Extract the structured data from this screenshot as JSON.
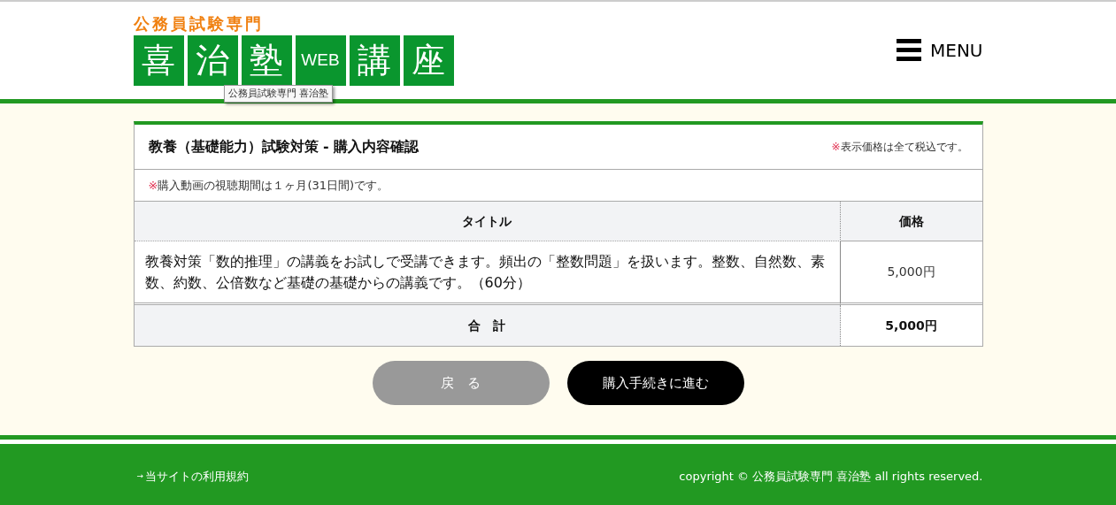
{
  "header": {
    "logo_caption": "公務員試験専門",
    "logo_tiles": [
      {
        "text": "喜",
        "kind": "kanji"
      },
      {
        "text": "治",
        "kind": "kanji"
      },
      {
        "text": "塾",
        "kind": "kanji"
      },
      {
        "text": "WEB",
        "kind": "latin"
      },
      {
        "text": "講",
        "kind": "kanji"
      },
      {
        "text": "座",
        "kind": "kanji"
      }
    ],
    "tooltip": "公務員試験専門 喜治塾",
    "menu_label": "MENU"
  },
  "panel": {
    "title": "教養（基礎能力）試験対策 - 購入内容確認",
    "tax_mark": "※",
    "tax_note": "表示価格は全て税込です。",
    "period_mark": "※",
    "period_note": "購入動画の視聴期間は１ヶ月(31日間)です。",
    "columns": [
      "タイトル",
      "価格"
    ],
    "rows": [
      {
        "title": "教養対策「数的推理」の講義をお試しで受講できます。頻出の「整数問題」を扱います。整数、自然数、素数、約数、公倍数など基礎の基礎からの講義です。（60分）",
        "price": "5,000円"
      }
    ],
    "total_label": "合　計",
    "total_value": "5,000円"
  },
  "buttons": [
    {
      "label": "戻　る",
      "kind": "secondary"
    },
    {
      "label": "購入手続きに進む",
      "kind": "primary"
    }
  ],
  "footer": {
    "arrow": "→",
    "link": "当サイトの利用規約",
    "copyright": "copyright © 公務員試験専門 喜治塾 all rights reserved."
  }
}
